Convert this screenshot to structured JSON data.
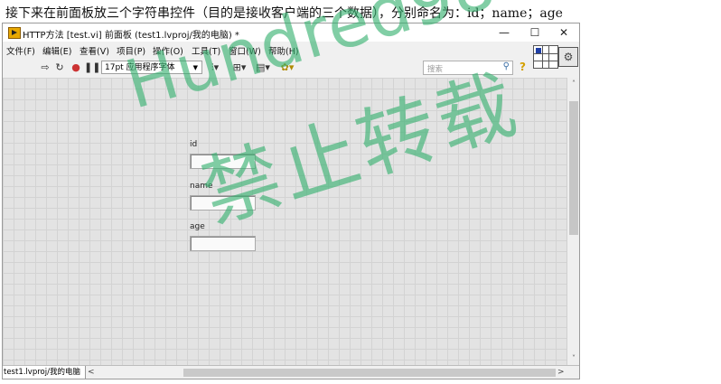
{
  "caption": "接下来在前面板放三个字符串控件（目的是接收客户端的三个数据），分别命名为：id；name；age",
  "window": {
    "title": "HTTP方法 [test.vi] 前面板 (test1.lvproj/我的电脑) *",
    "minimize": "—",
    "maximize": "☐",
    "close": "✕"
  },
  "menu": [
    "文件(F)",
    "编辑(E)",
    "查看(V)",
    "项目(P)",
    "操作(O)",
    "工具(T)",
    "窗口(W)",
    "帮助(H)"
  ],
  "toolbar": {
    "run_icon": "run-arrow-icon",
    "font_selector": "17pt 应用程序字体",
    "search_placeholder": "搜索",
    "help": "?"
  },
  "controls": [
    {
      "label": "id",
      "value": ""
    },
    {
      "label": "name",
      "value": ""
    },
    {
      "label": "age",
      "value": ""
    }
  ],
  "status": {
    "project_path": "test1.lvproj/我的电脑",
    "scroll_left": "<",
    "scroll_right": ">"
  },
  "scroll": {
    "up": "˄",
    "down": "˅"
  },
  "watermark": {
    "line1": "Hundred98",
    "line2": "禁止转载"
  }
}
